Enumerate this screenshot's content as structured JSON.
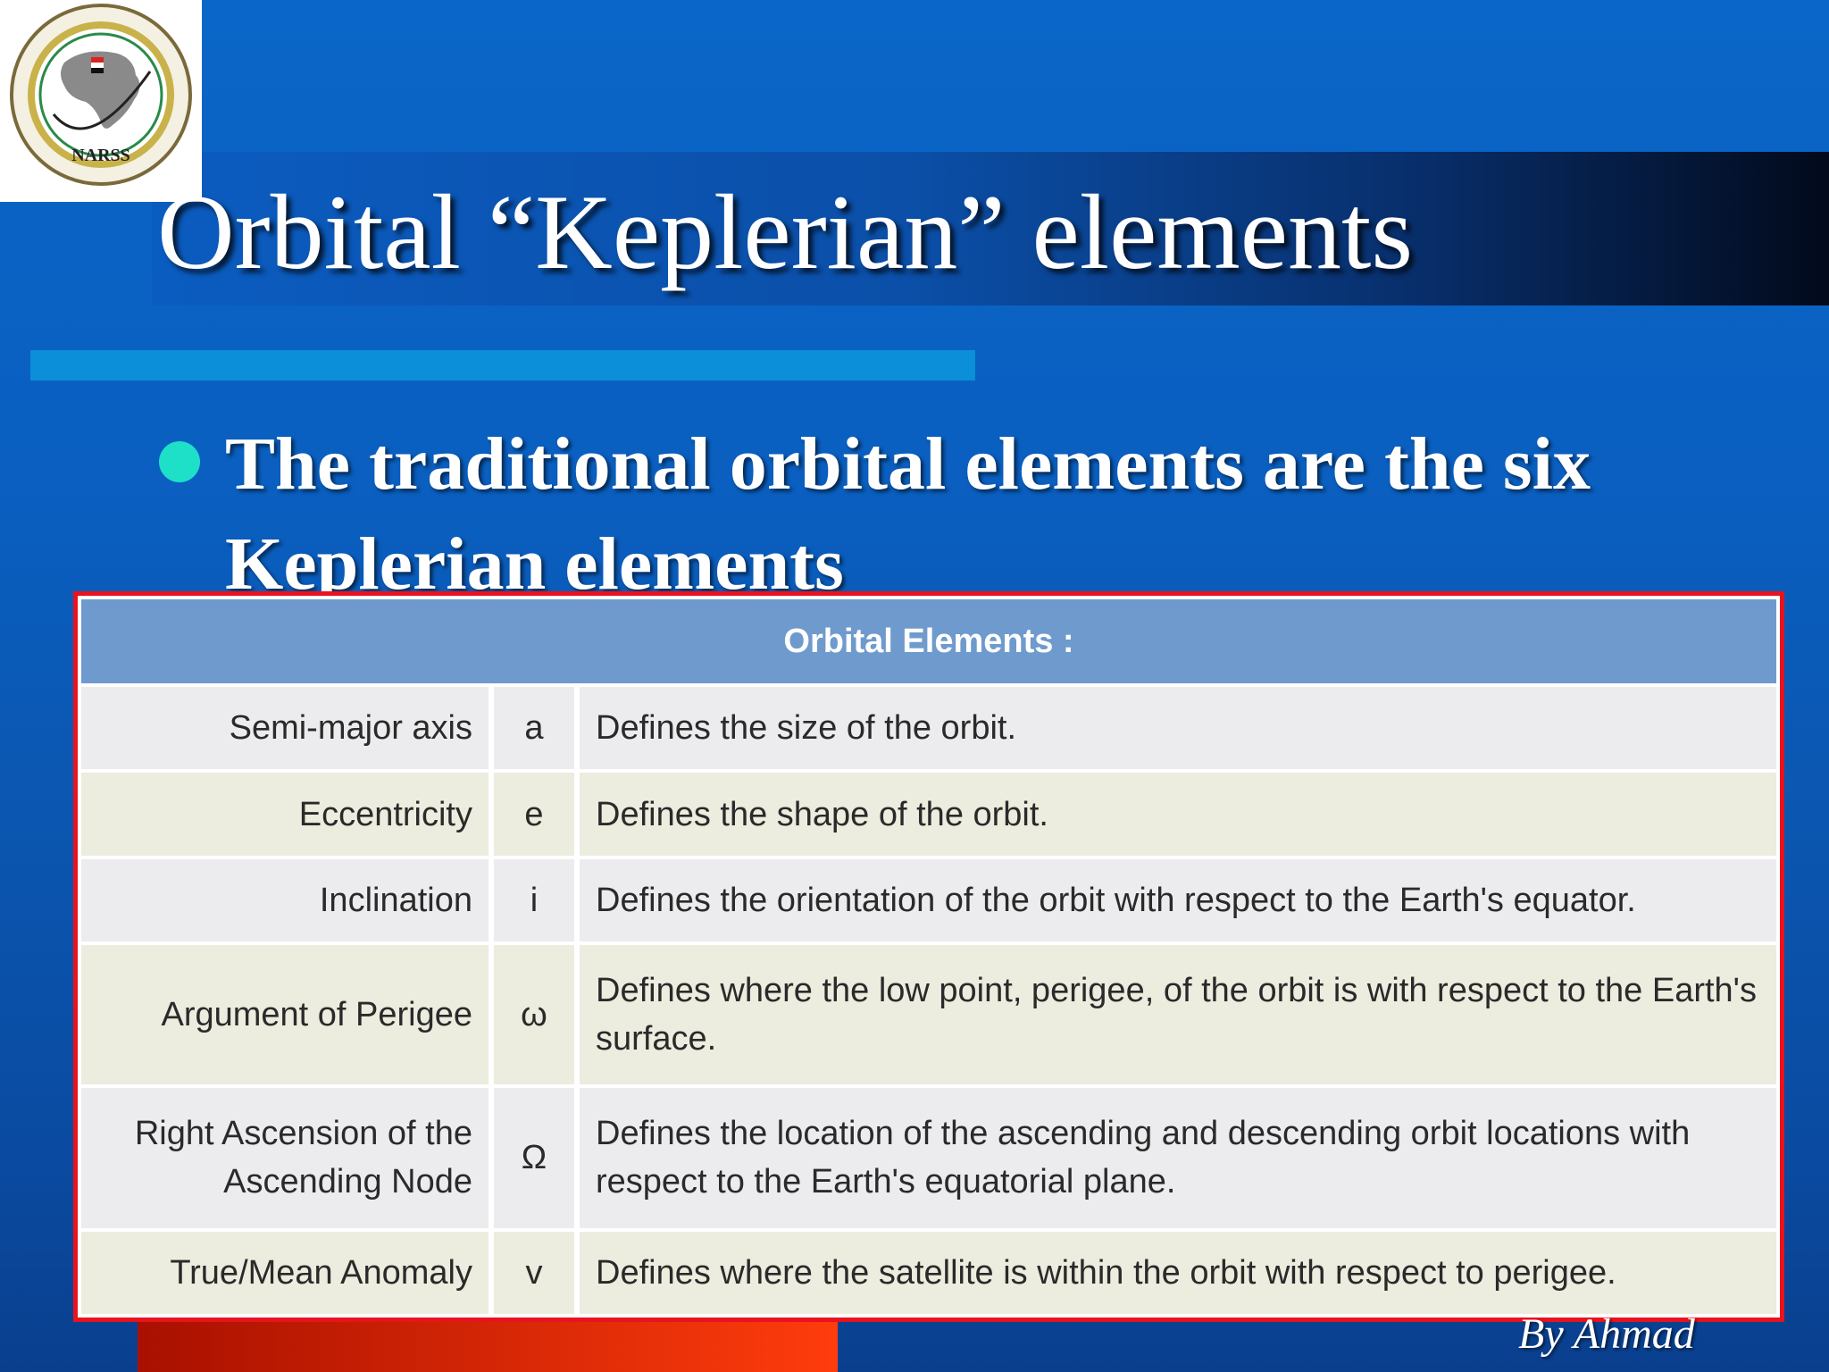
{
  "logo": {
    "text": "NARSS"
  },
  "title": "Orbital “Keplerian” elements",
  "bullet": "The traditional orbital elements are the six Keplerian elements",
  "table": {
    "header": "Orbital Elements :",
    "rows": [
      {
        "name": "Semi-major axis",
        "symbol": "a",
        "description": "Defines the size of the orbit."
      },
      {
        "name": "Eccentricity",
        "symbol": "e",
        "description": "Defines the shape of the orbit."
      },
      {
        "name": "Inclination",
        "symbol": "i",
        "description": "Defines the orientation of the orbit with respect to the Earth's equator."
      },
      {
        "name": "Argument of Perigee",
        "symbol": "ω",
        "description": "Defines where the low point, perigee, of the orbit is with respect to the Earth's surface."
      },
      {
        "name": "Right Ascension of the Ascending Node",
        "symbol": "Ω",
        "description": "Defines the location of the ascending and descending orbit locations with respect to the Earth's equatorial plane."
      },
      {
        "name": "True/Mean Anomaly",
        "symbol": "v",
        "description": "Defines where the satellite is within the orbit with respect to perigee."
      }
    ]
  },
  "author": "By Ahmad",
  "colors": {
    "background": "#0a5fc0",
    "table_border": "#e8131e",
    "table_header": "#6f9acd",
    "bullet": "#1ee0c8",
    "accent_bar": "#0a8fd8"
  }
}
